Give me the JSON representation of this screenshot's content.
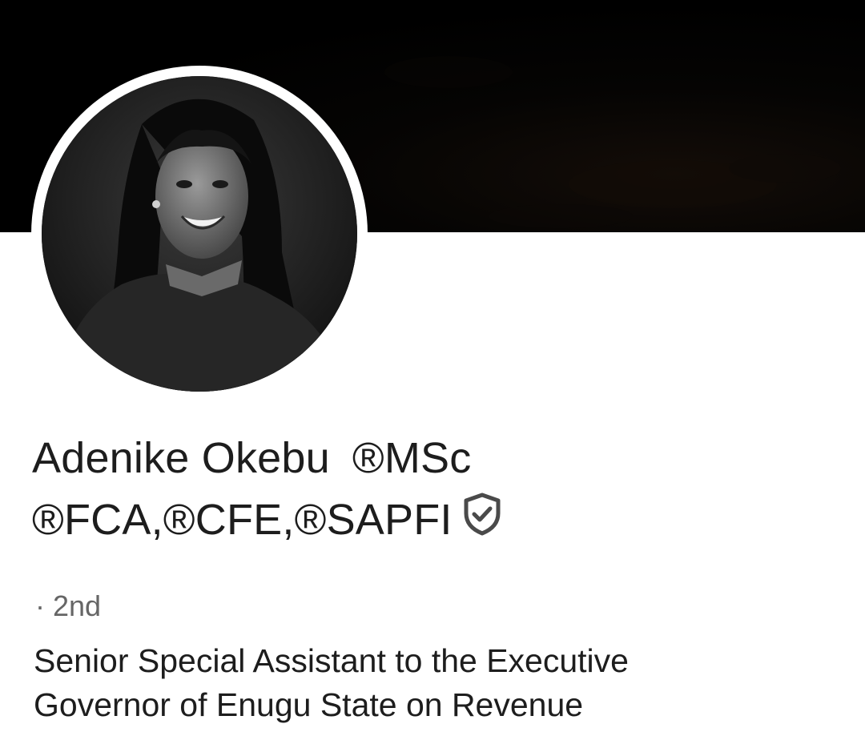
{
  "profile": {
    "name": "Adenike Okebu",
    "credentials_line1": "®MSc",
    "credentials_line2": "®FCA,®CFE,®SAPFI",
    "connection_degree": "· 2nd",
    "headline_line1": "Senior Special Assistant to the Executive",
    "headline_line2": "Governor of Enugu State on Revenue",
    "verified_icon": "shield-check-icon"
  },
  "colors": {
    "banner": "#000000",
    "background": "#ffffff",
    "name_text": "#1d1d1d",
    "secondary_text": "#666666",
    "icon": "#4a4a4a"
  }
}
